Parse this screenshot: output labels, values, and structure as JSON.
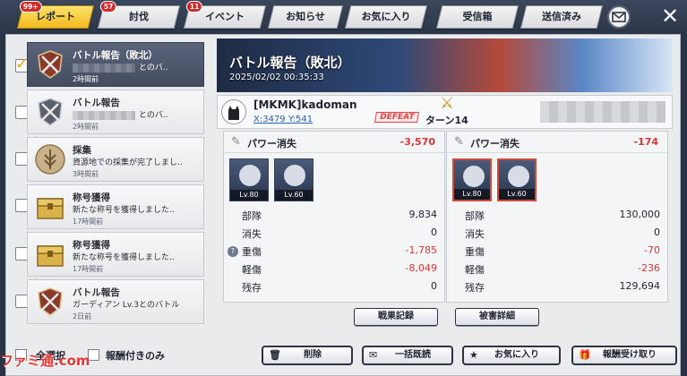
{
  "tabs": [
    {
      "label": "レポート",
      "badge": "99+",
      "active": true
    },
    {
      "label": "討伐",
      "badge": "57"
    },
    {
      "label": "イベント",
      "badge": "11"
    },
    {
      "label": "お知らせ",
      "badge": ""
    },
    {
      "label": "お気に入り",
      "badge": ""
    },
    {
      "label": "受信箱",
      "badge": ""
    },
    {
      "label": "送信済み",
      "badge": ""
    }
  ],
  "close_label": "✕",
  "list": [
    {
      "title": "バトル報告（敗北）",
      "desc": "とのバ..",
      "time": "2時間前",
      "checked": true
    },
    {
      "title": "バトル報告",
      "desc": "とのバ..",
      "time": "2時間前"
    },
    {
      "title": "採集",
      "desc": "資源地での採集が完了しまし..",
      "time": "3時間前"
    },
    {
      "title": "称号獲得",
      "desc": "新たな称号を獲得しました..",
      "time": "17時間前"
    },
    {
      "title": "称号獲得",
      "desc": "新たな称号を獲得しました..",
      "time": "17時間前"
    },
    {
      "title": "バトル報告",
      "desc": "ガーディアン Lv.3とのバトル",
      "time": "2日前"
    }
  ],
  "detail": {
    "title": "バトル報告（敗北）",
    "date": "2025/02/02 00:35:33",
    "player_name": "[MKMK]kadoman",
    "coords": "X:3479 Y:541",
    "result": "DEFEAT",
    "turn": "ターン14",
    "left": {
      "power_label": "パワー消失",
      "power_value": "-3,570",
      "heroes": [
        "Lv.80",
        "Lv.60"
      ],
      "stats": [
        {
          "k": "部隊",
          "v": "9,834",
          "neg": false
        },
        {
          "k": "消失",
          "v": "0",
          "neg": false
        },
        {
          "k": "重傷",
          "v": "-1,785",
          "neg": true
        },
        {
          "k": "軽傷",
          "v": "-8,049",
          "neg": true
        },
        {
          "k": "残存",
          "v": "0",
          "neg": false
        }
      ]
    },
    "right": {
      "power_label": "パワー消失",
      "power_value": "-174",
      "heroes": [
        "Lv.80",
        "Lv.60"
      ],
      "stats": [
        {
          "k": "部隊",
          "v": "130,000",
          "neg": false
        },
        {
          "k": "消失",
          "v": "0",
          "neg": false
        },
        {
          "k": "重傷",
          "v": "-70",
          "neg": true
        },
        {
          "k": "軽傷",
          "v": "-236",
          "neg": true
        },
        {
          "k": "残存",
          "v": "129,694",
          "neg": false
        }
      ]
    },
    "battle_log_btn": "戦果記録",
    "damage_btn": "被害詳細"
  },
  "bottom": {
    "select_all": "全選択",
    "reward_only": "報酬付きのみ",
    "delete": "削除",
    "read_all": "一括既読",
    "favorite": "お気に入り",
    "claim": "報酬受け取り"
  },
  "watermark": "ファミ通.com"
}
